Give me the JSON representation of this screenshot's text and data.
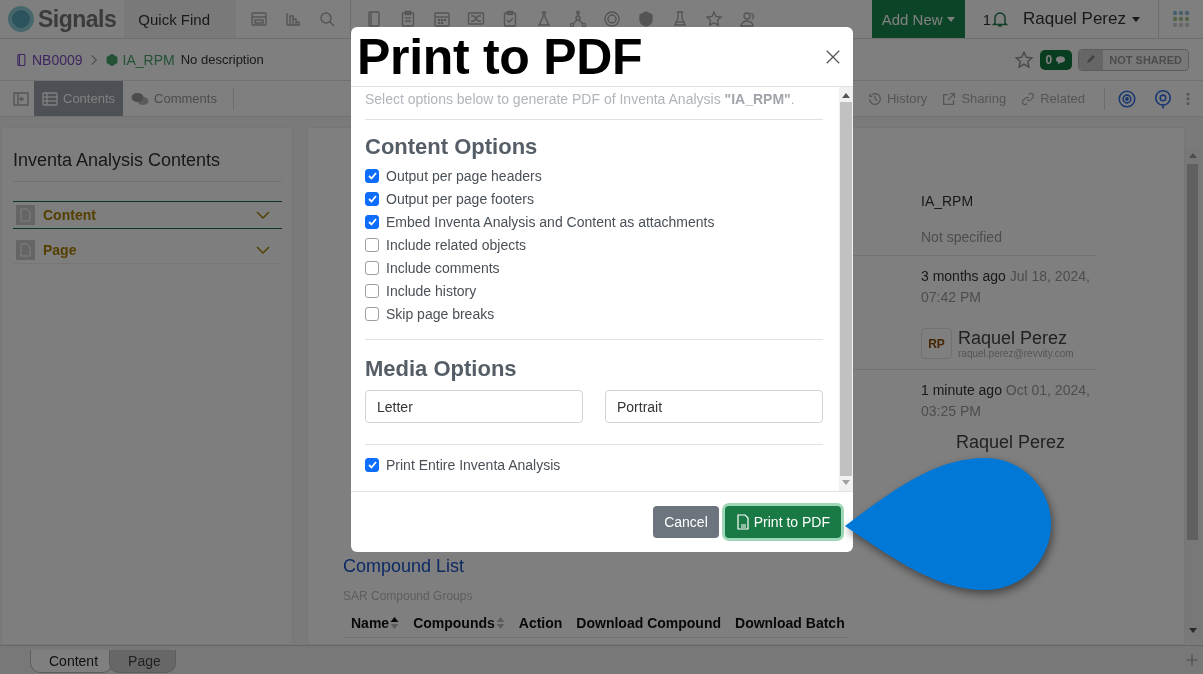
{
  "navbar": {
    "logo": "Signals",
    "quick_find": "Quick Find",
    "add_new": "Add New",
    "notification_count": "1",
    "user": "Raquel Perez"
  },
  "breadcrumb": {
    "notebook": "NB0009",
    "analysis": "IA_RPM",
    "description": "No description"
  },
  "header_actions": {
    "comment_count": "0",
    "share_status": "NOT SHARED"
  },
  "toolbar": {
    "tabs": [
      {
        "label": "Contents",
        "selected": true
      },
      {
        "label": "Comments",
        "selected": false
      }
    ],
    "actions": [
      "History",
      "Sharing",
      "Related"
    ]
  },
  "sidebar": {
    "title": "Inventa Analysis Contents",
    "items": [
      {
        "label": "Content",
        "selected": true
      },
      {
        "label": "Page",
        "selected": false
      }
    ]
  },
  "details": {
    "name": "IA_RPM",
    "description": "Not specified",
    "created": {
      "relative": "3 months ago",
      "date": "Jul 18, 2024, 07:42 PM"
    },
    "created_by": {
      "initials": "RP",
      "name": "Raquel Perez",
      "email": "raquel.perez@revvity.com"
    },
    "modified": {
      "relative": "1 minute ago",
      "date": "Oct 01, 2024, 03:25 PM"
    },
    "modified_by": {
      "name": "Raquel Perez"
    }
  },
  "compound_list": {
    "title": "Compound List",
    "subtitle": "SAR Compound Groups",
    "columns": [
      {
        "label": "Name",
        "sorted": true
      },
      {
        "label": "Compounds",
        "sorted": false
      },
      {
        "label": "Action"
      },
      {
        "label": "Download Compound"
      },
      {
        "label": "Download Batch"
      }
    ]
  },
  "bottom_tabs": [
    {
      "label": "Content",
      "selected": true
    },
    {
      "label": "Page",
      "selected": false
    }
  ],
  "dialog": {
    "title": "Print to PDF",
    "intro": "Select options below to generate PDF of Inventa Analysis **\"IA_RPM\"**.",
    "content_heading": "Content Options",
    "options": [
      {
        "label": "Output per page headers",
        "checked": true
      },
      {
        "label": "Output per page footers",
        "checked": true
      },
      {
        "label": "Embed Inventa Analysis and Content as attachments",
        "checked": true
      },
      {
        "label": "Include related objects",
        "checked": false
      },
      {
        "label": "Include comments",
        "checked": false
      },
      {
        "label": "Include history",
        "checked": false
      },
      {
        "label": "Skip page breaks",
        "checked": false
      }
    ],
    "media_heading": "Media Options",
    "media_fields": [
      {
        "value": "Letter"
      },
      {
        "value": "Portrait"
      }
    ],
    "final_option": {
      "label": "Print Entire Inventa Analysis",
      "checked": true
    },
    "buttons": [
      {
        "label": "Cancel",
        "kind": "secondary"
      },
      {
        "label": "Print to PDF",
        "kind": "primary"
      }
    ]
  }
}
